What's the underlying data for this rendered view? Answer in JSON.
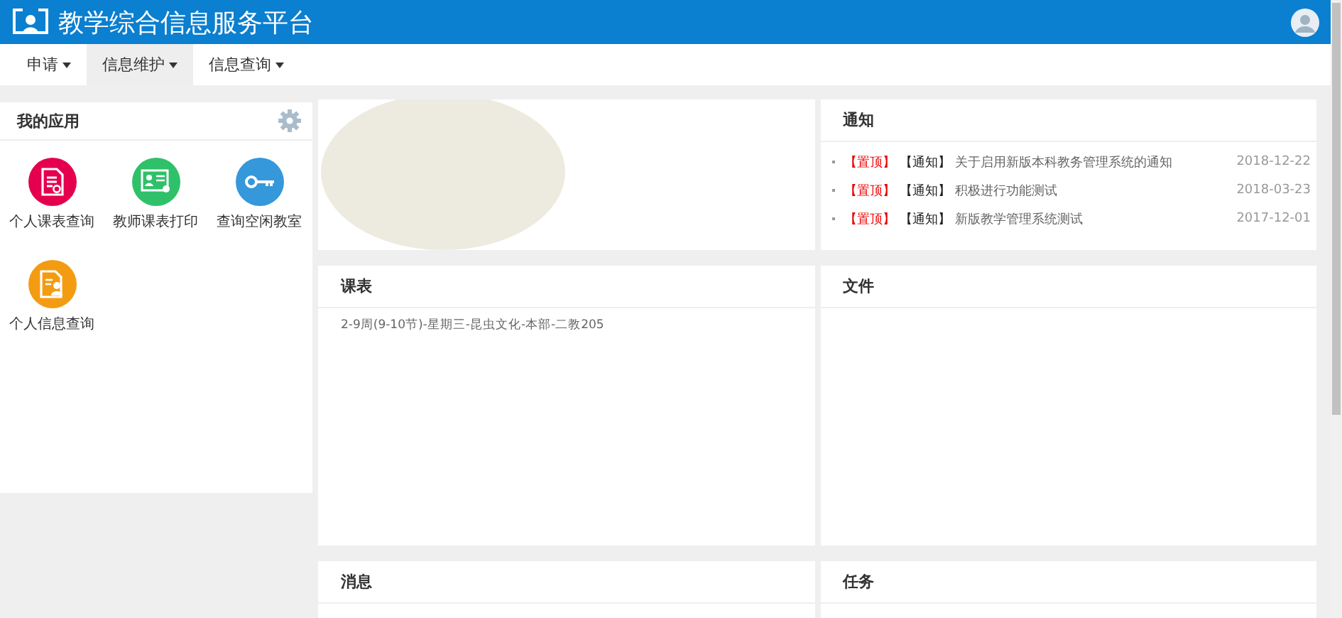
{
  "header": {
    "title": "教学综合信息服务平台"
  },
  "nav": [
    {
      "label": "申请",
      "selected": false
    },
    {
      "label": "信息维护",
      "selected": true
    },
    {
      "label": "信息查询",
      "selected": false
    }
  ],
  "apps_panel": {
    "title": "我的应用",
    "apps": [
      {
        "label": "个人课表查询",
        "kind": "document",
        "color": "#e5004f"
      },
      {
        "label": "教师课表打印",
        "kind": "card",
        "color": "#2fc06a"
      },
      {
        "label": "查询空闲教室",
        "kind": "key",
        "color": "#3498db"
      },
      {
        "label": "个人信息查询",
        "kind": "person",
        "color": "#f39c12"
      }
    ]
  },
  "notices": {
    "title": "通知",
    "items": [
      {
        "pin": "【置顶】",
        "tag": "【通知】",
        "text": "关于启用新版本科教务管理系统的通知",
        "date": "2018-12-22"
      },
      {
        "pin": "【置顶】",
        "tag": "【通知】",
        "text": "积极进行功能测试",
        "date": "2018-03-23"
      },
      {
        "pin": "【置顶】",
        "tag": "【通知】",
        "text": "新版教学管理系统测试",
        "date": "2017-12-01"
      }
    ]
  },
  "schedule": {
    "title": "课表",
    "items": [
      "2-9周(9-10节)-星期三-昆虫文化-本部-二教205"
    ]
  },
  "files": {
    "title": "文件"
  },
  "messages": {
    "title": "消息"
  },
  "tasks": {
    "title": "任务"
  }
}
